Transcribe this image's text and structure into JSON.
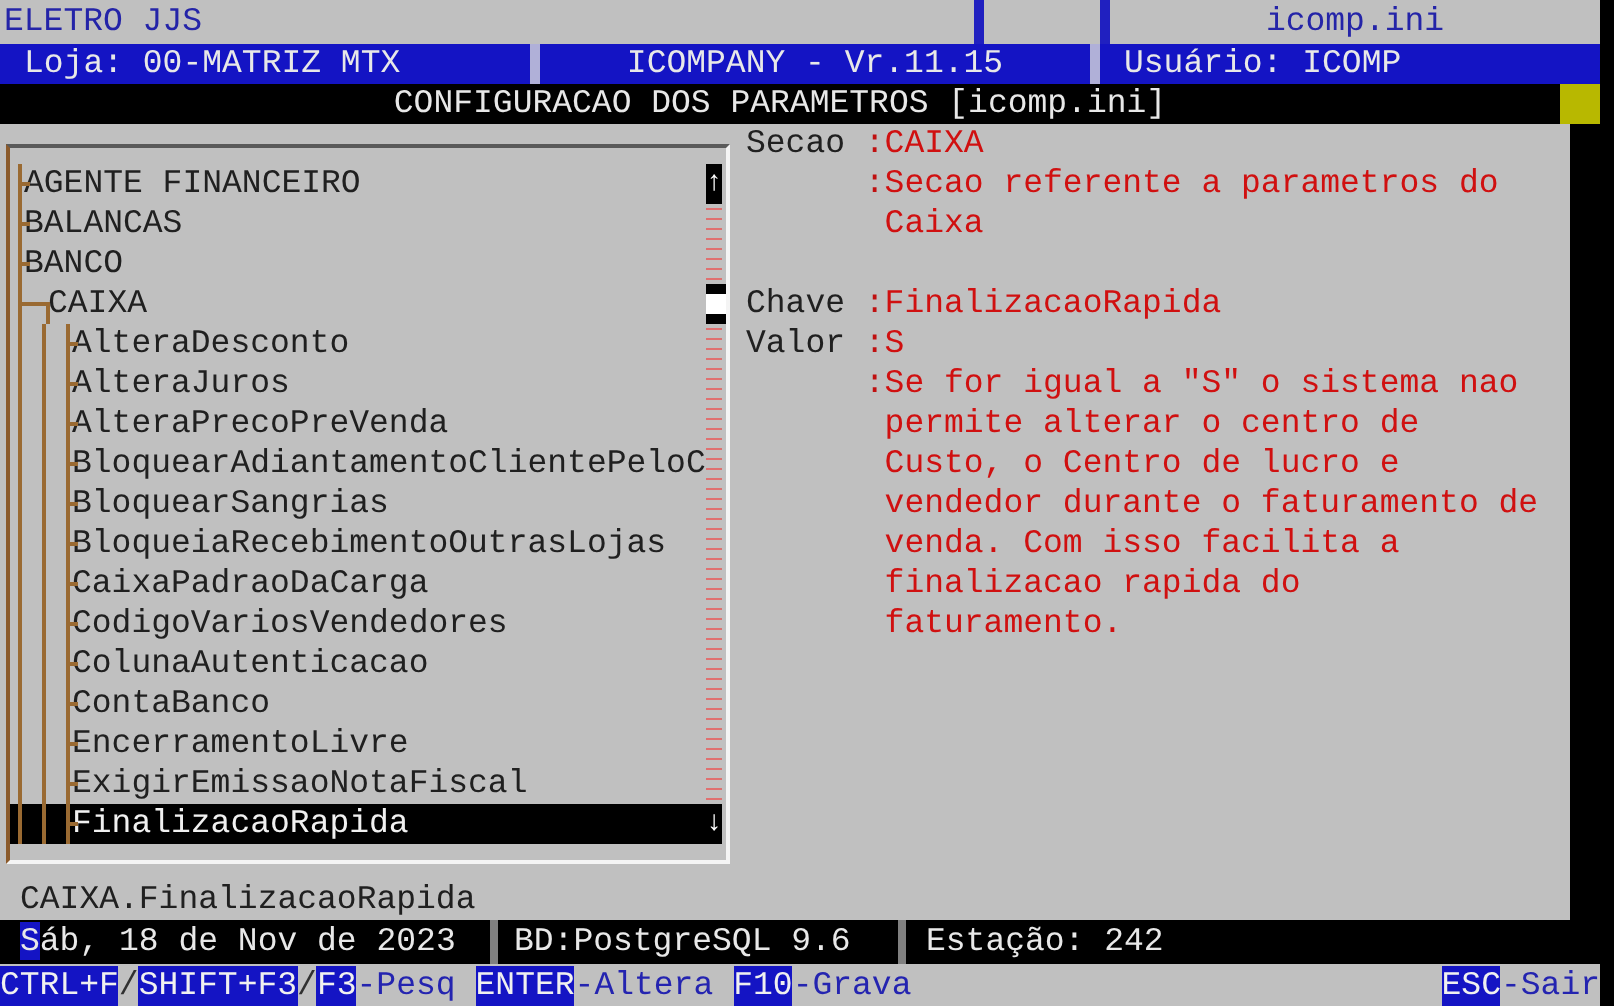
{
  "header": {
    "company": "ELETRO JJS",
    "file": "icomp.ini",
    "store": "Loja: 00-MATRIZ MTX",
    "version": "ICOMPANY - Vr.11.15",
    "user": "Usuário: ICOMP"
  },
  "title": "CONFIGURACAO DOS PARAMETROS [icomp.ini]",
  "tree": {
    "scroll_up": "↑",
    "scroll_down": "↓",
    "items": [
      {
        "label": "AGENTE FINANCEIRO",
        "selected": false,
        "expanded": false
      },
      {
        "label": "BALANCAS",
        "selected": false,
        "expanded": false
      },
      {
        "label": "BANCO",
        "selected": false,
        "expanded": false
      },
      {
        "label": "CAIXA",
        "selected": false,
        "expanded": true,
        "children": [
          {
            "label": "AlteraDesconto",
            "selected": false
          },
          {
            "label": "AlteraJuros",
            "selected": false
          },
          {
            "label": "AlteraPrecoPreVenda",
            "selected": false
          },
          {
            "label": "BloquearAdiantamentoClientePeloC",
            "selected": false
          },
          {
            "label": "BloquearSangrias",
            "selected": false
          },
          {
            "label": "BloqueiaRecebimentoOutrasLojas",
            "selected": false
          },
          {
            "label": "CaixaPadraoDaCarga",
            "selected": false
          },
          {
            "label": "CodigoVariosVendedores",
            "selected": false
          },
          {
            "label": "ColunaAutenticacao",
            "selected": false
          },
          {
            "label": "ContaBanco",
            "selected": false
          },
          {
            "label": "EncerramentoLivre",
            "selected": false
          },
          {
            "label": "ExigirEmissaoNotaFiscal",
            "selected": false
          },
          {
            "label": "FinalizacaoRapida",
            "selected": true
          }
        ]
      }
    ]
  },
  "detail_groups": [
    {
      "rows": [
        {
          "label": "Secao",
          "colon": ":",
          "value": "CAIXA"
        },
        {
          "colon": ":",
          "value": "Secao referente a parametros do Caixa"
        }
      ]
    },
    {
      "rows": [
        {
          "label": "Chave",
          "colon": ":",
          "value": "FinalizacaoRapida"
        },
        {
          "label": "Valor",
          "colon": ":",
          "value": "S"
        },
        {
          "colon": ":",
          "value": "Se for igual a \"S\" o sistema nao permite alterar o centro de Custo, o Centro de lucro e vendedor durante o faturamento de venda. Com isso facilita a finalizacao rapida do faturamento."
        }
      ]
    }
  ],
  "path": "CAIXA.FinalizacaoRapida",
  "status_bar": {
    "date": "Sáb, 18 de Nov de 2023",
    "database": "BD:PostgreSQL 9.6",
    "station": "Estação: 242"
  },
  "shortcuts": {
    "left": [
      {
        "kind": "key",
        "text": "CTRL+F"
      },
      {
        "kind": "sep",
        "text": "/"
      },
      {
        "kind": "key",
        "text": "SHIFT+F3"
      },
      {
        "kind": "sep",
        "text": "/"
      },
      {
        "kind": "key",
        "text": "F3"
      },
      {
        "kind": "label",
        "text": "-Pesq"
      },
      {
        "kind": "key",
        "text": "ENTER"
      },
      {
        "kind": "label",
        "text": "-Altera"
      },
      {
        "kind": "key",
        "text": "F10"
      },
      {
        "kind": "label",
        "text": "-Grava"
      }
    ],
    "right": [
      {
        "kind": "key",
        "text": "ESC"
      },
      {
        "kind": "label",
        "text": "-Sair"
      }
    ]
  }
}
